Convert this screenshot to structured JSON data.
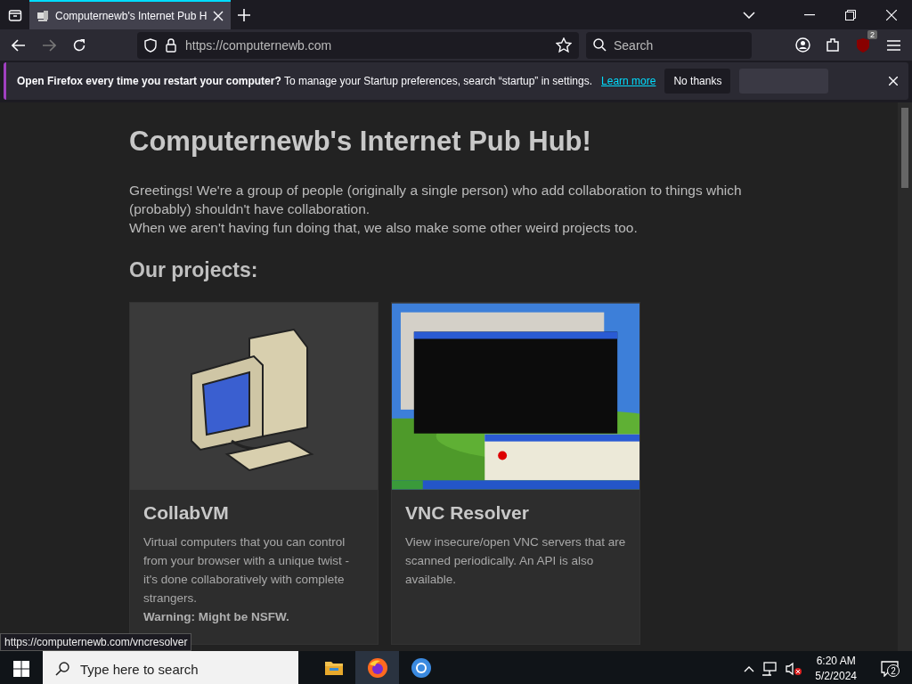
{
  "browser": {
    "tabs": [
      {
        "title": "Computernewb's Internet Pub H",
        "selected": true
      }
    ],
    "url": "https://computernewb.com",
    "search_placeholder": "Search",
    "extension_badge": "2"
  },
  "notification": {
    "bold_text": "Open Firefox every time you restart your computer?",
    "text": "To manage your Startup preferences, search “startup” in settings.",
    "link": "Learn more",
    "button": "No thanks"
  },
  "page": {
    "title": "Computernewb's Internet Pub Hub!",
    "intro_lines": [
      "Greetings! We're a group of people (originally a single person) who add collaboration to things which (probably) shouldn't have collaboration.",
      "When we aren't having fun doing that, we also make some other weird projects too."
    ],
    "section_heading": "Our projects:",
    "cards": [
      {
        "title": "CollabVM",
        "kind": "computer",
        "description": "Virtual computers that you can control from your browser with a unique twist - it's done collaboratively with complete strangers.",
        "warning": "Warning: Might be NSFW."
      },
      {
        "title": "VNC Resolver",
        "kind": "picture",
        "description": "View insecure/open VNC servers that are scanned periodically. An API is also available."
      }
    ]
  },
  "status_url": "https://computernewb.com/vncresolver",
  "taskbar": {
    "search_placeholder": "Type here to search",
    "apps": [
      {
        "kind": "folder",
        "selected": false
      },
      {
        "kind": "firefox",
        "selected": true
      },
      {
        "kind": "browser",
        "selected": false
      }
    ],
    "time": "6:20 AM",
    "date": "5/2/2024",
    "notification_count": "2"
  }
}
